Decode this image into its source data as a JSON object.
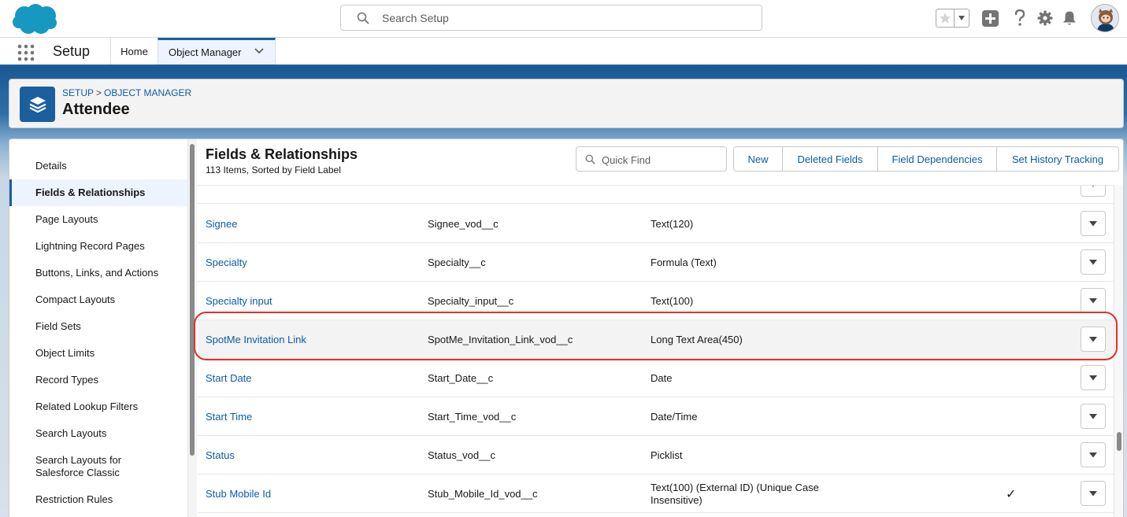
{
  "header": {
    "search_placeholder": "Search Setup"
  },
  "context": {
    "app_name": "Setup",
    "tabs": [
      {
        "label": "Home"
      },
      {
        "label": "Object Manager"
      }
    ]
  },
  "page_header": {
    "breadcrumb": [
      "SETUP",
      "OBJECT MANAGER"
    ],
    "breadcrumb_sep": ">",
    "title": "Attendee"
  },
  "sidebar": {
    "items": [
      {
        "label": "Details"
      },
      {
        "label": "Fields & Relationships",
        "active": true
      },
      {
        "label": "Page Layouts"
      },
      {
        "label": "Lightning Record Pages"
      },
      {
        "label": "Buttons, Links, and Actions"
      },
      {
        "label": "Compact Layouts"
      },
      {
        "label": "Field Sets"
      },
      {
        "label": "Object Limits"
      },
      {
        "label": "Record Types"
      },
      {
        "label": "Related Lookup Filters"
      },
      {
        "label": "Search Layouts"
      },
      {
        "label": "Search Layouts for\nSalesforce Classic"
      },
      {
        "label": "Restriction Rules"
      }
    ]
  },
  "content": {
    "title": "Fields & Relationships",
    "subtitle": "113 Items, Sorted by Field Label",
    "quick_find_placeholder": "Quick Find",
    "buttons": {
      "new": "New",
      "deleted_fields": "Deleted Fields",
      "field_dependencies": "Field Dependencies",
      "set_history_tracking": "Set History Tracking"
    },
    "rows": [
      {
        "label": "Signee",
        "api": "Signee_vod__c",
        "type": "Text(120)",
        "indexed": ""
      },
      {
        "label": "Specialty",
        "api": "Specialty__c",
        "type": "Formula (Text)",
        "indexed": ""
      },
      {
        "label": "Specialty input",
        "api": "Specialty_input__c",
        "type": "Text(100)",
        "indexed": ""
      },
      {
        "label": "SpotMe Invitation Link",
        "api": "SpotMe_Invitation_Link_vod__c",
        "type": "Long Text Area(450)",
        "indexed": "",
        "highlighted": true
      },
      {
        "label": "Start Date",
        "api": "Start_Date__c",
        "type": "Date",
        "indexed": ""
      },
      {
        "label": "Start Time",
        "api": "Start_Time_vod__c",
        "type": "Date/Time",
        "indexed": ""
      },
      {
        "label": "Status",
        "api": "Status_vod__c",
        "type": "Picklist",
        "indexed": ""
      },
      {
        "label": "Stub Mobile Id",
        "api": "Stub_Mobile_Id_vod__c",
        "type": "Text(100) (External ID) (Unique Case Insensitive)",
        "indexed": "✓"
      }
    ]
  },
  "colors": {
    "brand": "#1b5f9e",
    "link": "#0b5cab",
    "highlight_ring": "#e0312b"
  }
}
